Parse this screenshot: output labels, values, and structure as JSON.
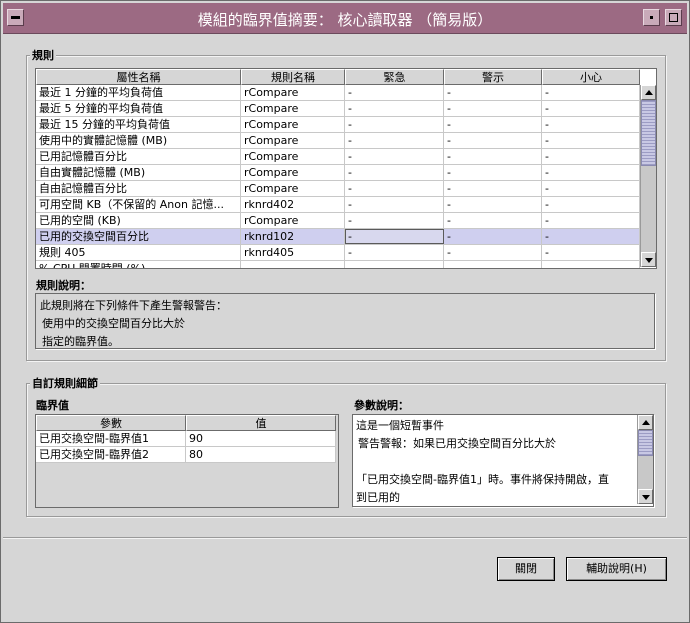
{
  "window": {
    "title": "模組的臨界值摘要：  核心讀取器 （簡易版）"
  },
  "rules": {
    "group_label": "規則",
    "columns": [
      "屬性名稱",
      "規則名稱",
      "緊急",
      "警示",
      "小心"
    ],
    "rows": [
      [
        "最近 1 分鐘的平均負荷值",
        "rCompare",
        "-",
        "-",
        "-"
      ],
      [
        "最近 5 分鐘的平均負荷值",
        "rCompare",
        "-",
        "-",
        "-"
      ],
      [
        "最近 15 分鐘的平均負荷值",
        "rCompare",
        "-",
        "-",
        "-"
      ],
      [
        "使用中的實體記憶體 (MB)",
        "rCompare",
        "-",
        "-",
        "-"
      ],
      [
        "已用記憶體百分比",
        "rCompare",
        "-",
        "-",
        "-"
      ],
      [
        "自由實體記憶體 (MB)",
        "rCompare",
        "-",
        "-",
        "-"
      ],
      [
        "自由記憶體百分比",
        "rCompare",
        "-",
        "-",
        "-"
      ],
      [
        "可用空間 KB（不保留的 Anon 記憶...",
        "rknrd402",
        "-",
        "-",
        "-"
      ],
      [
        "已用的空間 (KB)",
        "rCompare",
        "-",
        "-",
        "-"
      ],
      [
        "已用的交換空間百分比",
        "rknrd102",
        "-",
        "-",
        "-"
      ],
      [
        "規則 405",
        "rknrd405",
        "-",
        "-",
        "-"
      ],
      [
        "% CPU 閒置時間 (%)",
        "-",
        "-",
        "-",
        "-"
      ]
    ],
    "selected_row": 9
  },
  "rule_desc": {
    "label": "規則說明：",
    "lines": [
      "此規則將在下列條件下產生警報警告：",
      "使用中的交換空間百分比大於",
      "指定的臨界值。"
    ]
  },
  "custom": {
    "group_label": "自訂規則細節",
    "threshold_label": "臨界值",
    "param_columns": [
      "參數",
      "值"
    ],
    "params": [
      [
        "已用交換空間-臨界值1",
        "90"
      ],
      [
        "已用交換空間-臨界值2",
        "80"
      ]
    ],
    "param_desc_label": "參數說明：",
    "param_desc_lines": [
      "這是一個短暫事件",
      "警告警報：如果已用交換空間百分比大於",
      "",
      "「已用交換空間-臨界值1」時。事件將保持開啟，直",
      "到已用的"
    ]
  },
  "buttons": {
    "close": "關閉",
    "help": "輔助說明(H)"
  }
}
